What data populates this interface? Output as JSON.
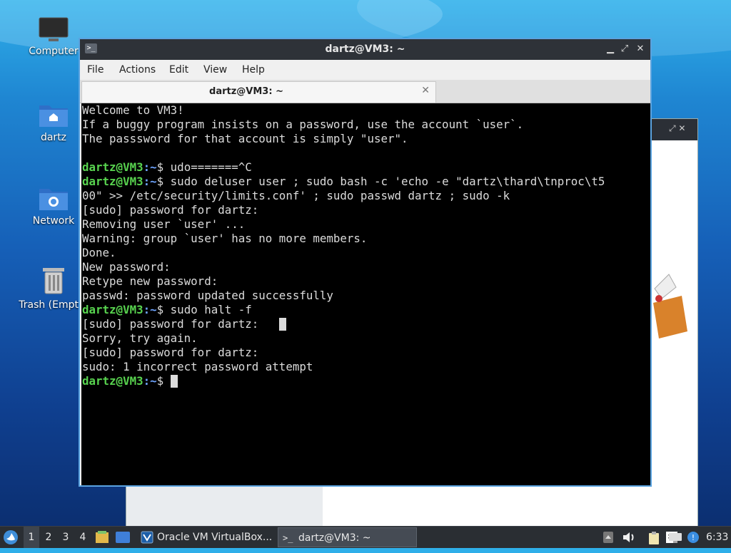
{
  "desktop": {
    "icons": [
      {
        "label": "Computer"
      },
      {
        "label": "dartz"
      },
      {
        "label": "Network"
      },
      {
        "label": "Trash (Empty)"
      }
    ]
  },
  "terminal": {
    "window_title": "dartz@VM3: ~",
    "menu": [
      "File",
      "Actions",
      "Edit",
      "View",
      "Help"
    ],
    "tab_label": "dartz@VM3: ~",
    "prompt_user": "dartz@VM3",
    "prompt_colon": ":",
    "prompt_path": "~",
    "prompt_dollar": "$ ",
    "lines": [
      "Welcome to VM3!",
      "If a buggy program insists on a password, use the account `user`.",
      "The passsword for that account is simply \"user\".",
      "",
      "udo=======^C",
      "sudo deluser user ; sudo bash -c 'echo -e \"dartz\\thard\\tnproc\\t5",
      "00\" >> /etc/security/limits.conf' ; sudo passwd dartz ; sudo -k",
      "[sudo] password for dartz:",
      "Removing user `user' ...",
      "Warning: group `user' has no more members.",
      "Done.",
      "New password:",
      "Retype new password:",
      "passwd: password updated successfully",
      "sudo halt -f",
      "[sudo] password for dartz:   ",
      "Sorry, try again.",
      "[sudo] password for dartz:",
      "sudo: 1 incorrect password attempt",
      ""
    ]
  },
  "taskbar": {
    "workspaces": [
      "1",
      "2",
      "3",
      "4"
    ],
    "tasks": [
      "Oracle VM VirtualBox...",
      "dartz@VM3: ~"
    ],
    "clock": "6:33"
  }
}
